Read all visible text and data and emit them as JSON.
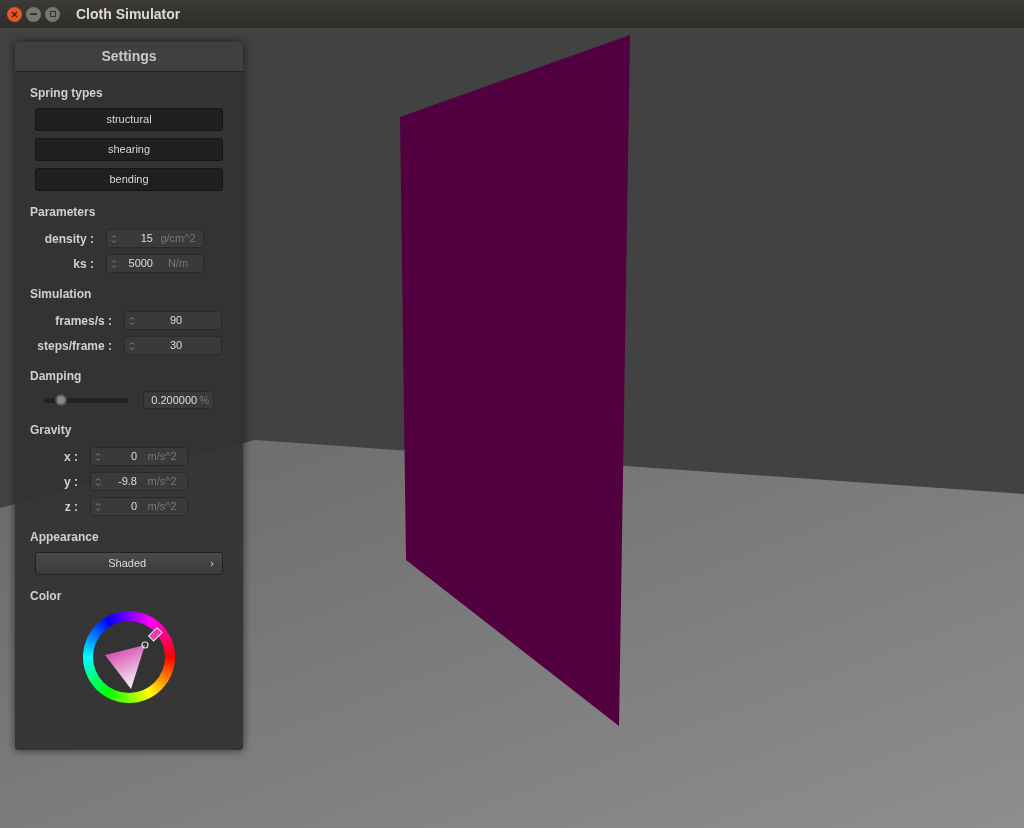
{
  "window": {
    "title": "Cloth Simulator"
  },
  "panel": {
    "title": "Settings",
    "spring_types": {
      "heading": "Spring types",
      "buttons": [
        "structural",
        "shearing",
        "bending"
      ]
    },
    "parameters": {
      "heading": "Parameters",
      "fields": [
        {
          "label": "density :",
          "value": "15",
          "unit": "g/cm^2"
        },
        {
          "label": "ks :",
          "value": "5000",
          "unit": "N/m"
        }
      ]
    },
    "simulation": {
      "heading": "Simulation",
      "fields": [
        {
          "label": "frames/s :",
          "value": "90"
        },
        {
          "label": "steps/frame :",
          "value": "30"
        }
      ]
    },
    "damping": {
      "heading": "Damping",
      "level": 0.2,
      "value": "0.200000",
      "unit": "%"
    },
    "gravity": {
      "heading": "Gravity",
      "fields": [
        {
          "label": "x :",
          "value": "0",
          "unit": "m/s^2"
        },
        {
          "label": "y :",
          "value": "-9.8",
          "unit": "m/s^2"
        },
        {
          "label": "z :",
          "value": "0",
          "unit": "m/s^2"
        }
      ]
    },
    "appearance": {
      "heading": "Appearance",
      "value": "Shaded",
      "arrow": "›"
    },
    "color": {
      "heading": "Color"
    }
  }
}
